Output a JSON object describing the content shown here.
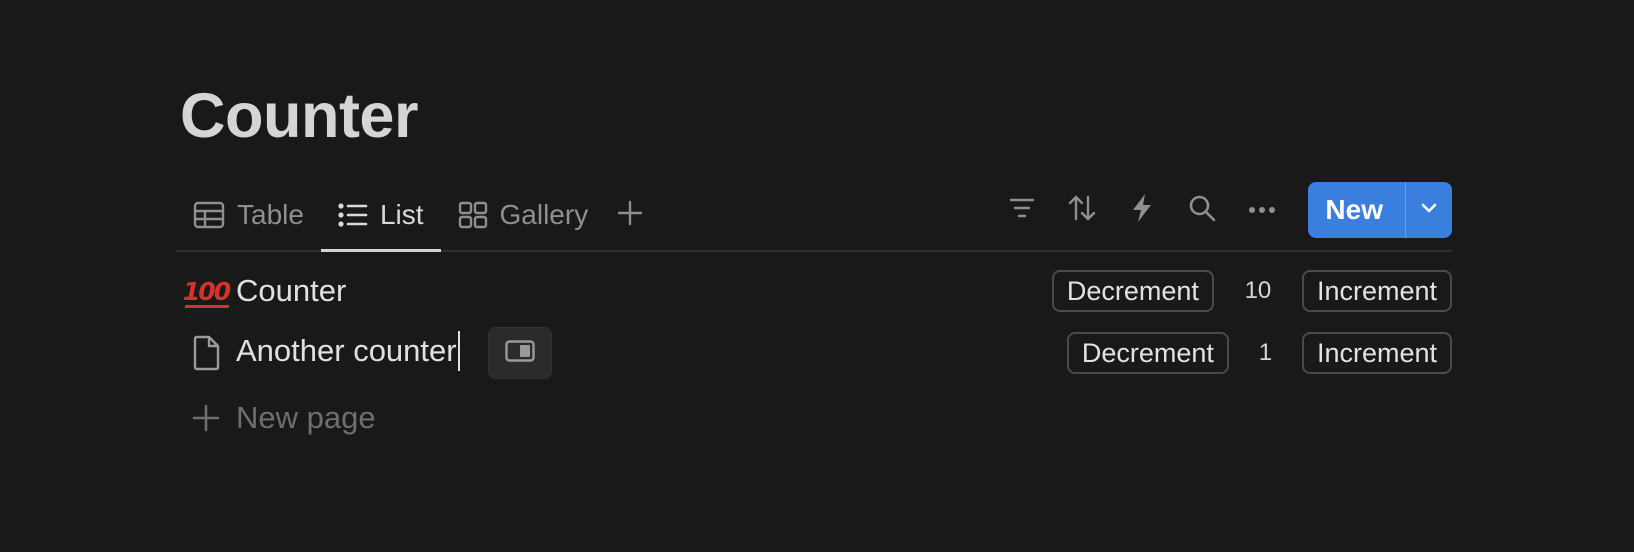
{
  "page": {
    "title": "Counter"
  },
  "views": {
    "tabs": [
      {
        "label": "Table",
        "icon": "table-icon",
        "active": false
      },
      {
        "label": "List",
        "icon": "list-icon",
        "active": true
      },
      {
        "label": "Gallery",
        "icon": "gallery-icon",
        "active": false
      }
    ],
    "add_view_icon": "plus-icon"
  },
  "toolbar": {
    "icons": [
      "filter-icon",
      "sort-icon",
      "automation-icon",
      "search-icon",
      "more-icon"
    ],
    "new_label": "New",
    "new_caret_icon": "chevron-down-icon",
    "accent": "#3a7fdd"
  },
  "rows": [
    {
      "icon": "hundred-points-emoji",
      "icon_text": "100",
      "name": "Counter",
      "decrement_label": "Decrement",
      "count": "10",
      "increment_label": "Increment"
    },
    {
      "icon": "page-icon",
      "name": "Another counter",
      "decrement_label": "Decrement",
      "count": "1",
      "increment_label": "Increment",
      "open_icon": "side-peek-icon"
    }
  ],
  "new_page": {
    "label": "New page",
    "icon": "plus-icon"
  }
}
